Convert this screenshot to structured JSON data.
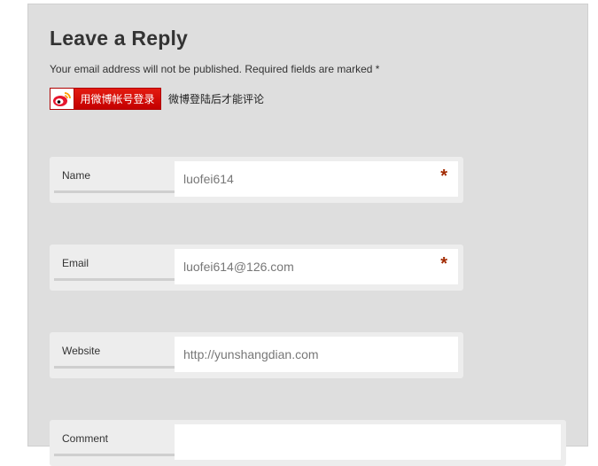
{
  "reply": {
    "title": "Leave a Reply",
    "notice": "Your email address will not be published. Required fields are marked *"
  },
  "weibo": {
    "button_label": "用微博帐号登录",
    "hint": "微博登陆后才能评论",
    "logo_icon": "weibo-logo-icon"
  },
  "fields": {
    "name": {
      "label": "Name",
      "value": "luofei614",
      "required_mark": "*"
    },
    "email": {
      "label": "Email",
      "value": "luofei614@126.com",
      "required_mark": "*"
    },
    "website": {
      "label": "Website",
      "value": "http://yunshangdian.com"
    },
    "comment": {
      "label": "Comment",
      "value": ""
    }
  },
  "colors": {
    "panel_bg": "#dedede",
    "weibo_red": "#d40d0d",
    "required_star": "#a22a00"
  }
}
